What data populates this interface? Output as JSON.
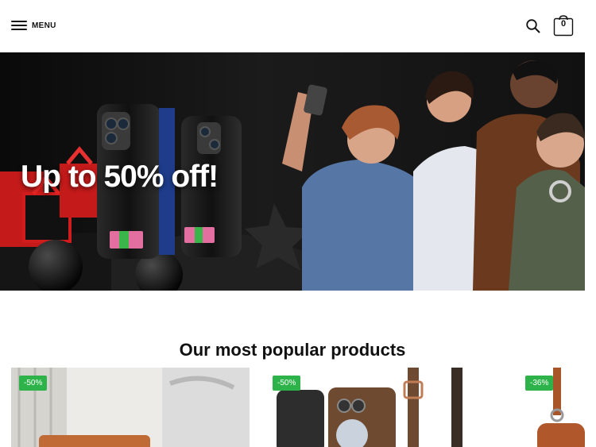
{
  "header": {
    "menu_label": "MENU",
    "search_icon": "search-icon",
    "cart_icon": "shopping-bag-icon",
    "cart_count": "0"
  },
  "hero": {
    "headline": "Up to 50% off!"
  },
  "section": {
    "title": "Our most popular products"
  },
  "products": [
    {
      "badge": "-50%"
    },
    {
      "badge": "-50%"
    },
    {
      "badge": "-36%"
    }
  ],
  "colors": {
    "badge": "#2eb34a",
    "hero_background": "#0d0d0d",
    "text": "#111111"
  }
}
